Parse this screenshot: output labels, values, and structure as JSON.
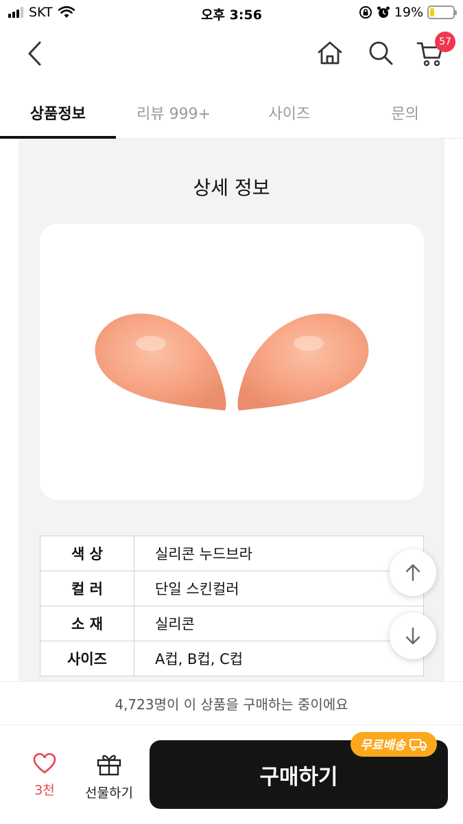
{
  "status_bar": {
    "carrier": "SKT",
    "time": "오후 3:56",
    "battery_percent": "19%",
    "battery_level": 0.19,
    "icons": [
      "signal-icon",
      "wifi-icon",
      "orientation-lock-icon",
      "alarm-icon",
      "battery-icon"
    ]
  },
  "header": {
    "icons": [
      "back-arrow-icon",
      "home-icon",
      "search-icon",
      "cart-icon"
    ],
    "cart_count": "57"
  },
  "tabs": [
    {
      "label": "상품정보",
      "active": true
    },
    {
      "label": "리뷰 999+",
      "active": false
    },
    {
      "label": "사이즈",
      "active": false
    },
    {
      "label": "문의",
      "active": false
    }
  ],
  "detail": {
    "title": "상세 정보",
    "image_description_icon": "product-image",
    "specs": [
      {
        "key": "색 상",
        "value": "실리콘 누드브라"
      },
      {
        "key": "컬 러",
        "value": "단일 스킨컬러"
      },
      {
        "key": "소 재",
        "value": "실리콘"
      },
      {
        "key": "사이즈",
        "value": "A컵, B컵, C컵"
      }
    ]
  },
  "scroll_buttons": [
    "scroll-up-icon",
    "scroll-down-icon"
  ],
  "buyers_notice": "4,723명이 이 상품을 구매하는 중이에요",
  "bottom_bar": {
    "like_count": "3천",
    "gift_label": "선물하기",
    "buy_label": "구매하기",
    "shipping_badge": "무료배송"
  },
  "colors": {
    "accent_red": "#f0374e",
    "badge_orange": "#fca81c",
    "buy_button": "#141414"
  }
}
